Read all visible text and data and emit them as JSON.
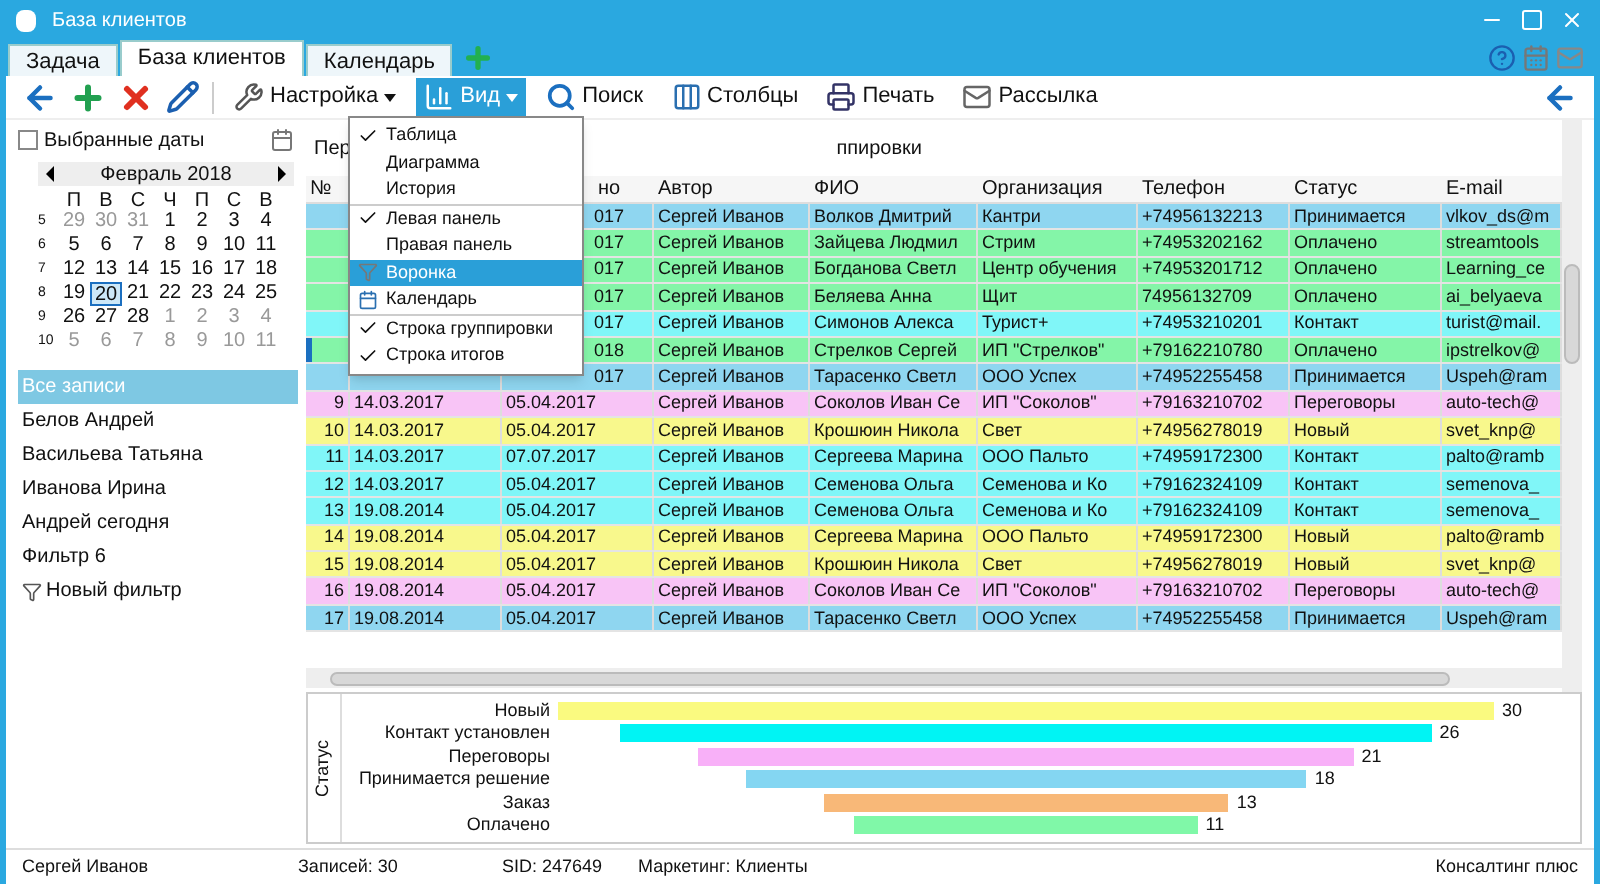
{
  "window": {
    "title": "База клиентов"
  },
  "tabs": [
    {
      "label": "Задача",
      "selected": false
    },
    {
      "label": "База клиентов",
      "selected": true
    },
    {
      "label": "Календарь",
      "selected": false
    }
  ],
  "toolbar": {
    "icon_buttons": [
      {
        "kind": "back"
      },
      {
        "kind": "add"
      },
      {
        "kind": "delete"
      },
      {
        "kind": "edit"
      }
    ],
    "buttons": [
      {
        "kind": "settings",
        "label": "Настройка",
        "dropdown": true,
        "pressed": false
      },
      {
        "kind": "view",
        "label": "Вид",
        "dropdown": true,
        "pressed": true
      },
      {
        "kind": "search",
        "label": "Поиск",
        "dropdown": false,
        "pressed": false
      },
      {
        "kind": "columns",
        "label": "Столбцы",
        "dropdown": false,
        "pressed": false
      },
      {
        "kind": "print",
        "label": "Печать",
        "dropdown": false,
        "pressed": false
      },
      {
        "kind": "mail",
        "label": "Рассылка",
        "dropdown": false,
        "pressed": false
      }
    ]
  },
  "view_menu": {
    "groups": [
      [
        {
          "kind": "check",
          "label": "Таблица",
          "checked": true,
          "selected": false
        },
        {
          "kind": "check",
          "label": "Диаграмма",
          "checked": false,
          "selected": false
        },
        {
          "kind": "check",
          "label": "История",
          "checked": false,
          "selected": false
        }
      ],
      [
        {
          "kind": "check",
          "label": "Левая панель",
          "checked": true,
          "selected": false
        },
        {
          "kind": "check",
          "label": "Правая панель",
          "checked": false,
          "selected": false
        },
        {
          "kind": "funnel",
          "label": "Воронка",
          "checked": false,
          "selected": true
        },
        {
          "kind": "calendar",
          "label": "Календарь",
          "checked": false,
          "selected": false
        }
      ],
      [
        {
          "kind": "check",
          "label": "Строка группировки",
          "checked": true,
          "selected": false
        },
        {
          "kind": "check",
          "label": "Строка итогов",
          "checked": true,
          "selected": false
        }
      ]
    ]
  },
  "date_filter": {
    "label": "Выбранные даты",
    "checked": false
  },
  "calendar": {
    "month": "Февраль 2018",
    "weekdays": [
      "П",
      "В",
      "С",
      "Ч",
      "П",
      "С",
      "В"
    ],
    "weeks": [
      {
        "number": "5",
        "days": [
          {
            "day": "29",
            "other_month": true,
            "selected": false
          },
          {
            "day": "30",
            "other_month": true,
            "selected": false
          },
          {
            "day": "31",
            "other_month": true,
            "selected": false
          },
          {
            "day": "1",
            "other_month": false,
            "selected": false
          },
          {
            "day": "2",
            "other_month": false,
            "selected": false
          },
          {
            "day": "3",
            "other_month": false,
            "selected": false
          },
          {
            "day": "4",
            "other_month": false,
            "selected": false
          }
        ]
      },
      {
        "number": "6",
        "days": [
          {
            "day": "5",
            "other_month": false,
            "selected": false
          },
          {
            "day": "6",
            "other_month": false,
            "selected": false
          },
          {
            "day": "7",
            "other_month": false,
            "selected": false
          },
          {
            "day": "8",
            "other_month": false,
            "selected": false
          },
          {
            "day": "9",
            "other_month": false,
            "selected": false
          },
          {
            "day": "10",
            "other_month": false,
            "selected": false
          },
          {
            "day": "11",
            "other_month": false,
            "selected": false
          }
        ]
      },
      {
        "number": "7",
        "days": [
          {
            "day": "12",
            "other_month": false,
            "selected": false
          },
          {
            "day": "13",
            "other_month": false,
            "selected": false
          },
          {
            "day": "14",
            "other_month": false,
            "selected": false
          },
          {
            "day": "15",
            "other_month": false,
            "selected": false
          },
          {
            "day": "16",
            "other_month": false,
            "selected": false
          },
          {
            "day": "17",
            "other_month": false,
            "selected": false
          },
          {
            "day": "18",
            "other_month": false,
            "selected": false
          }
        ]
      },
      {
        "number": "8",
        "days": [
          {
            "day": "19",
            "other_month": false,
            "selected": false
          },
          {
            "day": "20",
            "other_month": false,
            "selected": true
          },
          {
            "day": "21",
            "other_month": false,
            "selected": false
          },
          {
            "day": "22",
            "other_month": false,
            "selected": false
          },
          {
            "day": "23",
            "other_month": false,
            "selected": false
          },
          {
            "day": "24",
            "other_month": false,
            "selected": false
          },
          {
            "day": "25",
            "other_month": false,
            "selected": false
          }
        ]
      },
      {
        "number": "9",
        "days": [
          {
            "day": "26",
            "other_month": false,
            "selected": false
          },
          {
            "day": "27",
            "other_month": false,
            "selected": false
          },
          {
            "day": "28",
            "other_month": false,
            "selected": false
          },
          {
            "day": "1",
            "other_month": true,
            "selected": false
          },
          {
            "day": "2",
            "other_month": true,
            "selected": false
          },
          {
            "day": "3",
            "other_month": true,
            "selected": false
          },
          {
            "day": "4",
            "other_month": true,
            "selected": false
          }
        ]
      },
      {
        "number": "10",
        "days": [
          {
            "day": "5",
            "other_month": true,
            "selected": false
          },
          {
            "day": "6",
            "other_month": true,
            "selected": false
          },
          {
            "day": "7",
            "other_month": true,
            "selected": false
          },
          {
            "day": "8",
            "other_month": true,
            "selected": false
          },
          {
            "day": "9",
            "other_month": true,
            "selected": false
          },
          {
            "day": "10",
            "other_month": true,
            "selected": false
          },
          {
            "day": "11",
            "other_month": true,
            "selected": false
          }
        ]
      }
    ]
  },
  "filters": [
    {
      "label": "Все записи",
      "selected": true
    },
    {
      "label": "Белов Андрей",
      "selected": false
    },
    {
      "label": "Васильева Татьяна",
      "selected": false
    },
    {
      "label": "Иванова Ирина",
      "selected": false
    },
    {
      "label": "Андрей сегодня",
      "selected": false
    },
    {
      "label": "Фильтр 6",
      "selected": false
    }
  ],
  "new_filter": {
    "label": "Новый фильтр"
  },
  "grid": {
    "group_panel": {
      "left": "Пер",
      "right": "ппировки"
    },
    "columns": [
      "№",
      null,
      "но",
      "Автор",
      "ФИО",
      "Организация",
      "Телефон",
      "Статус",
      "E-mail"
    ],
    "rows": [
      {
        "color": "#8fd6f0",
        "selected": false,
        "cells": [
          null,
          null,
          "017",
          "Сергей Иванов",
          "Волков Дмитрий",
          "Кантри",
          "+74956132213",
          "Принимается",
          "vlkov_ds@m"
        ]
      },
      {
        "color": "#84f5a8",
        "selected": false,
        "cells": [
          null,
          null,
          "017",
          "Сергей Иванов",
          "Зайцева Людмил",
          "Стрим",
          "+74953202162",
          "Оплачено",
          "streamtools"
        ]
      },
      {
        "color": "#84f5a8",
        "selected": false,
        "cells": [
          null,
          null,
          "017",
          "Сергей Иванов",
          "Богданова Светл",
          "Центр обучения",
          "+74953201712",
          "Оплачено",
          "Learning_ce"
        ]
      },
      {
        "color": "#84f5a8",
        "selected": false,
        "cells": [
          null,
          null,
          "017",
          "Сергей Иванов",
          "Беляева Анна",
          "Щит",
          "74956132709",
          "Оплачено",
          "ai_belyaeva"
        ]
      },
      {
        "color": "#80f6f8",
        "selected": false,
        "cells": [
          null,
          null,
          "017",
          "Сергей Иванов",
          "Симонов Алекса",
          "Турист+",
          "+74953210201",
          "Контакт",
          "turist@mail."
        ]
      },
      {
        "color": "#84f5a8",
        "selected": true,
        "cells": [
          null,
          null,
          "018",
          "Сергей Иванов",
          "Стрелков Сергей",
          "ИП \"Стрелков\"",
          "+79162210780",
          "Оплачено",
          "ipstrelkov@"
        ]
      },
      {
        "color": "#8fd6f0",
        "selected": false,
        "cells": [
          null,
          null,
          "017",
          "Сергей Иванов",
          "Тарасенко Светл",
          "ООО Успех",
          "+74952255458",
          "Принимается",
          "Uspeh@ram"
        ]
      },
      {
        "color": "#f8c4f6",
        "selected": false,
        "cells": [
          "9",
          "14.03.2017",
          "05.04.2017",
          "Сергей Иванов",
          "Соколов Иван Се",
          "ИП \"Соколов\"",
          "+79163210702",
          "Переговоры",
          "auto-tech@"
        ]
      },
      {
        "color": "#f8f88c",
        "selected": false,
        "cells": [
          "10",
          "14.03.2017",
          "05.04.2017",
          "Сергей Иванов",
          "Крошюин Никола",
          "Свет",
          "+74956278019",
          "Новый",
          "svet_knp@"
        ]
      },
      {
        "color": "#80f6f8",
        "selected": false,
        "cells": [
          "11",
          "14.03.2017",
          "07.07.2017",
          "Сергей Иванов",
          "Сергеева Марина",
          "ООО Пальто",
          "+74959172300",
          "Контакт",
          "palto@ramb"
        ]
      },
      {
        "color": "#80f6f8",
        "selected": false,
        "cells": [
          "12",
          "14.03.2017",
          "05.04.2017",
          "Сергей Иванов",
          "Семенова Ольга",
          "Семенова и Ко",
          "+79162324109",
          "Контакт",
          "semenova_"
        ]
      },
      {
        "color": "#80f6f8",
        "selected": false,
        "cells": [
          "13",
          "19.08.2014",
          "05.04.2017",
          "Сергей Иванов",
          "Семенова Ольга",
          "Семенова и Ко",
          "+79162324109",
          "Контакт",
          "semenova_"
        ]
      },
      {
        "color": "#f8f88c",
        "selected": false,
        "cells": [
          "14",
          "19.08.2014",
          "05.04.2017",
          "Сергей Иванов",
          "Сергеева Марина",
          "ООО Пальто",
          "+74959172300",
          "Новый",
          "palto@ramb"
        ]
      },
      {
        "color": "#f8f88c",
        "selected": false,
        "cells": [
          "15",
          "19.08.2014",
          "05.04.2017",
          "Сергей Иванов",
          "Крошюин Никола",
          "Свет",
          "+74956278019",
          "Новый",
          "svet_knp@"
        ]
      },
      {
        "color": "#f8c4f6",
        "selected": false,
        "cells": [
          "16",
          "19.08.2014",
          "05.04.2017",
          "Сергей Иванов",
          "Соколов Иван Се",
          "ИП \"Соколов\"",
          "+79163210702",
          "Переговоры",
          "auto-tech@"
        ]
      },
      {
        "color": "#8fd6f0",
        "selected": false,
        "cells": [
          "17",
          "19.08.2014",
          "05.04.2017",
          "Сергей Иванов",
          "Тарасенко Светл",
          "ООО Успех",
          "+74952255458",
          "Принимается",
          "Uspeh@ram"
        ]
      }
    ]
  },
  "funnel": {
    "axis_title": "Статус",
    "stages": [
      {
        "label": "Новый",
        "count": "30",
        "color": "#fafa80"
      },
      {
        "label": "Контакт установлен",
        "count": "26",
        "color": "#00f4f4"
      },
      {
        "label": "Переговоры",
        "count": "21",
        "color": "#f8b0f8"
      },
      {
        "label": "Принимается решение",
        "count": "18",
        "color": "#84d6f2"
      },
      {
        "label": "Заказ",
        "count": "13",
        "color": "#f8b878"
      },
      {
        "label": "Оплачено",
        "count": "11",
        "color": "#80f8a8"
      }
    ]
  },
  "status_bar": {
    "user": "Сергей Иванов",
    "records": "Записей: 30",
    "sid": "SID: 247649",
    "module": "Маркетинг: Клиенты",
    "company": "Консалтинг плюс"
  }
}
